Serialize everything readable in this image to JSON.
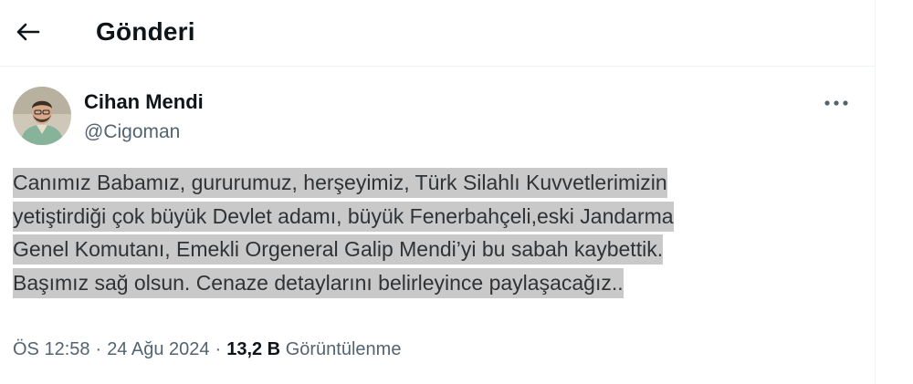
{
  "header": {
    "title": "Gönderi",
    "back_icon": "arrow-left-icon"
  },
  "author": {
    "display_name": "Cihan Mendi",
    "handle": "@Cigoman",
    "avatar_icon": "user-avatar"
  },
  "more_icon": "more-horizontal-icon",
  "tweet": {
    "lines": [
      "Canımız Babamız, gururumuz, herşeyimiz, Türk Silahlı Kuvvetlerimizin",
      "yetiştirdiği çok büyük Devlet adamı, büyük Fenerbahçeli,eski Jandarma",
      "Genel Komutanı, Emekli Orgeneral Galip Mendi’yi bu sabah kaybettik.",
      "Başımız sağ olsun. Cenaze detaylarını belirleyince paylaşacağız.."
    ],
    "highlight_color": "#c9c9c9"
  },
  "meta": {
    "time": "ÖS 12:58",
    "separator": "·",
    "date": "24 Ağu 2024",
    "views_count": "13,2 B",
    "views_label": "Görüntülenme"
  },
  "colors": {
    "text_primary": "#0f1419",
    "text_secondary": "#536471",
    "border": "#eff3f4"
  }
}
